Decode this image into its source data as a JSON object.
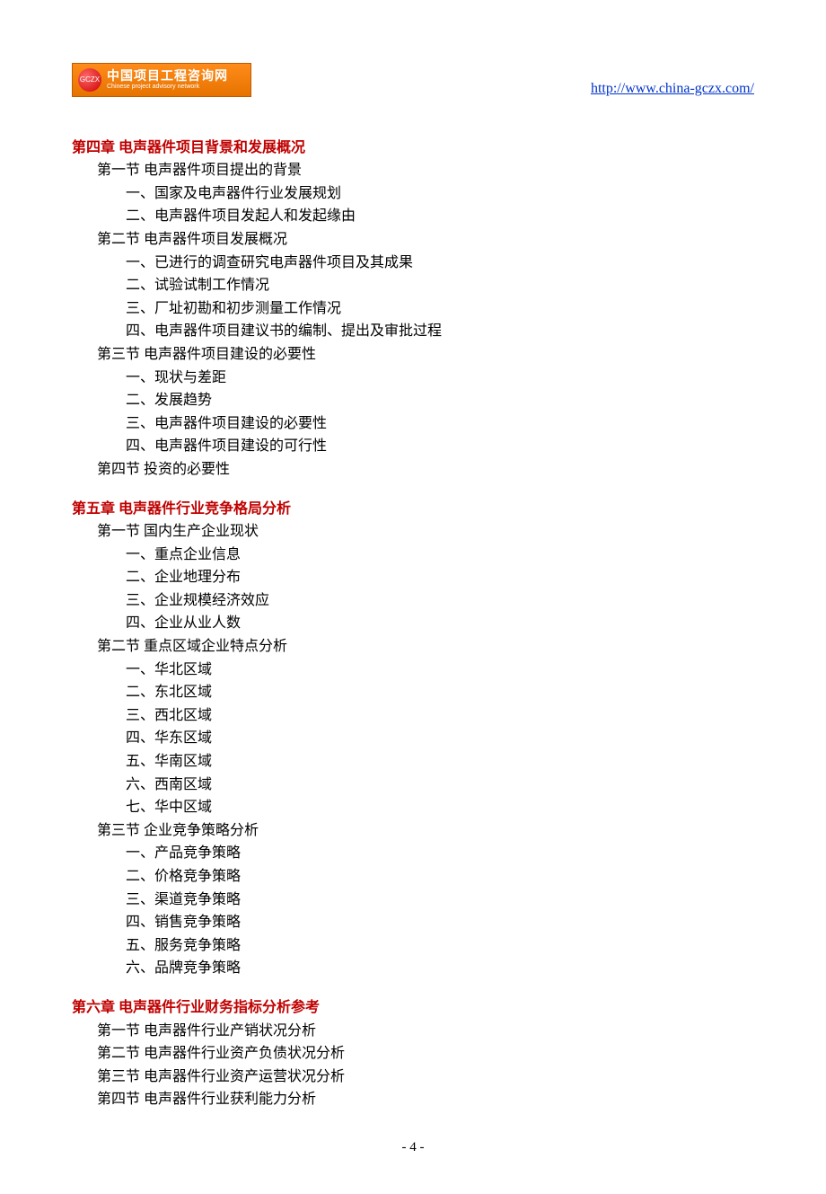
{
  "header": {
    "logo_abbr": "GCZX",
    "logo_cn": "中国项目工程咨询网",
    "logo_en": "Chinese project advisory network",
    "url": "http://www.china-gczx.com/"
  },
  "chapters": [
    {
      "title": "第四章  电声器件项目背景和发展概况",
      "sections": [
        {
          "title": "第一节  电声器件项目提出的背景",
          "items": [
            "一、国家及电声器件行业发展规划",
            "二、电声器件项目发起人和发起缘由"
          ]
        },
        {
          "title": "第二节  电声器件项目发展概况",
          "items": [
            "一、已进行的调查研究电声器件项目及其成果",
            "二、试验试制工作情况",
            "三、厂址初勘和初步测量工作情况",
            "四、电声器件项目建议书的编制、提出及审批过程"
          ]
        },
        {
          "title": "第三节  电声器件项目建设的必要性",
          "items": [
            "一、现状与差距",
            "二、发展趋势",
            "三、电声器件项目建设的必要性",
            "四、电声器件项目建设的可行性"
          ]
        },
        {
          "title": "第四节   投资的必要性",
          "items": []
        }
      ]
    },
    {
      "title": "第五章  电声器件行业竞争格局分析",
      "sections": [
        {
          "title": "第一节   国内生产企业现状",
          "items": [
            "一、重点企业信息",
            "二、企业地理分布",
            "三、企业规模经济效应",
            "四、企业从业人数"
          ]
        },
        {
          "title": "第二节   重点区域企业特点分析",
          "items": [
            "一、华北区域",
            "二、东北区域",
            "三、西北区域",
            "四、华东区域",
            "五、华南区域",
            "六、西南区域",
            "七、华中区域"
          ]
        },
        {
          "title": "第三节   企业竞争策略分析",
          "items": [
            "一、产品竞争策略",
            "二、价格竞争策略",
            "三、渠道竞争策略",
            "四、销售竞争策略",
            "五、服务竞争策略",
            "六、品牌竞争策略"
          ]
        }
      ]
    },
    {
      "title": "第六章  电声器件行业财务指标分析参考",
      "sections": [
        {
          "title": "第一节  电声器件行业产销状况分析",
          "items": []
        },
        {
          "title": "第二节  电声器件行业资产负债状况分析",
          "items": []
        },
        {
          "title": "第三节  电声器件行业资产运营状况分析",
          "items": []
        },
        {
          "title": "第四节  电声器件行业获利能力分析",
          "items": []
        }
      ]
    }
  ],
  "page_number": "- 4 -"
}
